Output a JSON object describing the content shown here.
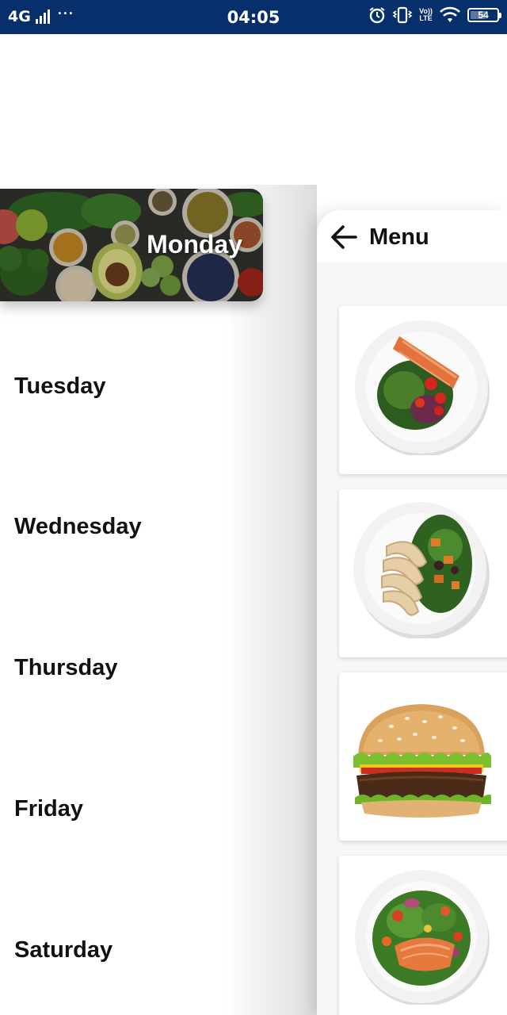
{
  "status_bar": {
    "network": "4G",
    "more": "···",
    "time": "04:05",
    "battery": "54",
    "lte_top": "Vo))",
    "lte_bottom": "LTE"
  },
  "days": {
    "selected": "Monday",
    "items": [
      "Tuesday",
      "Wednesday",
      "Thursday",
      "Friday",
      "Saturday"
    ]
  },
  "menu": {
    "title": "Menu",
    "items": [
      "salmon-salad-image",
      "chicken-salad-image",
      "burger-image",
      "salmon-greens-image"
    ]
  },
  "colors": {
    "status_bar": "#072f6b",
    "panel_background": "#f7f7f7",
    "text": "#111111"
  }
}
